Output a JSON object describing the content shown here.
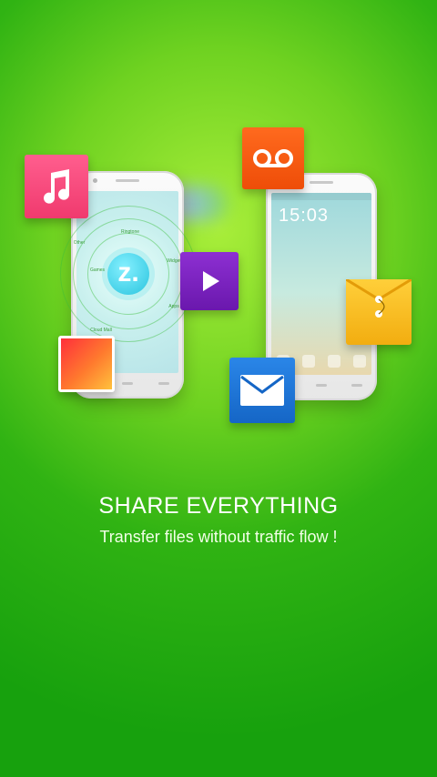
{
  "left_phone": {
    "center_glyph": "z.",
    "mini_labels": [
      "Ringtone",
      "Widget",
      "Apps",
      "Cloud Mall",
      "Games",
      "Other"
    ]
  },
  "right_phone": {
    "clock": "15:03"
  },
  "icons": [
    "music-note-icon",
    "voicemail-icon",
    "video-play-icon",
    "envelope-folder-icon",
    "gallery-photo-icon",
    "mail-icon"
  ],
  "colors": {
    "background_center": "#a9ee3a",
    "background_edge": "#17a10d",
    "music_tile": "#f03a6e",
    "voicemail_tile": "#ee4d08",
    "video_tile": "#6a18ad",
    "envelope_tile": "#f2ad10",
    "mail_tile": "#1566c6"
  },
  "text": {
    "title": "SHARE EVERYTHING",
    "subtitle": "Transfer files without traffic flow !"
  }
}
